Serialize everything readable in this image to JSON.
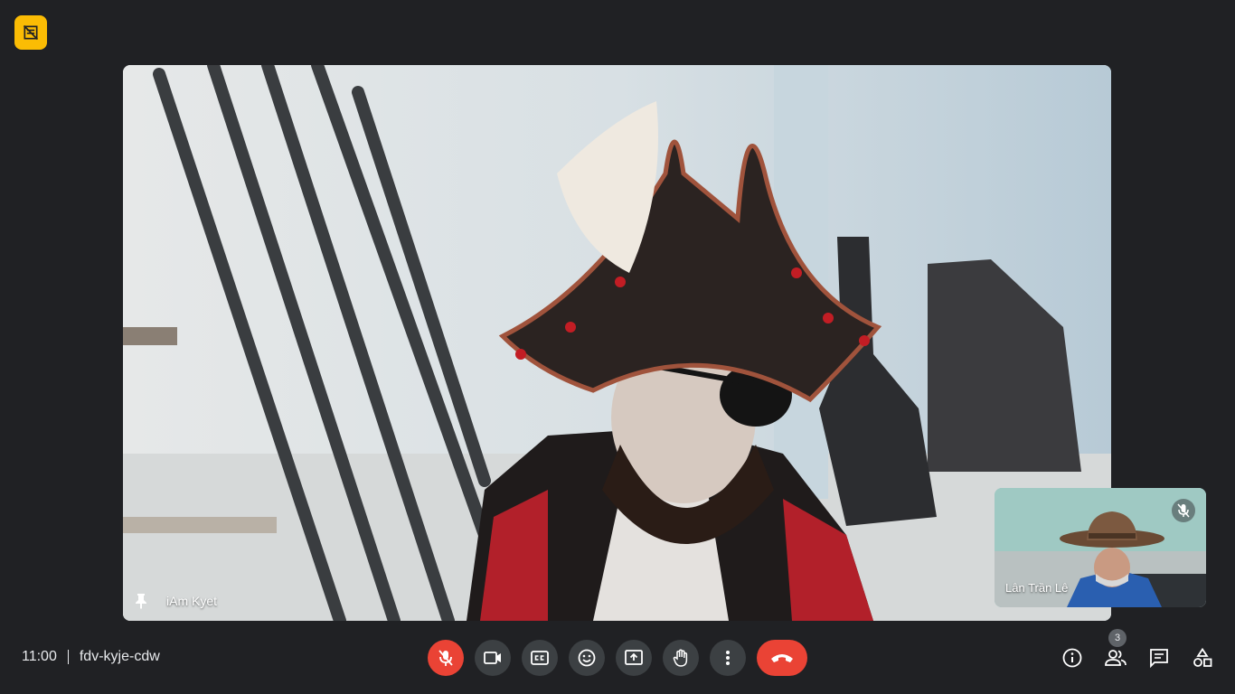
{
  "meeting": {
    "time": "11:00",
    "code": "fdv-kyje-cdw",
    "participant_count": "3"
  },
  "main_tile": {
    "name": "iAm Kyet"
  },
  "self_tile": {
    "name": "Lân Trần Lê"
  },
  "controls": [
    {
      "id": "mic",
      "icon": "mic-off-icon",
      "state": "muted"
    },
    {
      "id": "camera",
      "icon": "videocam-icon"
    },
    {
      "id": "captions",
      "icon": "closed-caption-icon"
    },
    {
      "id": "reactions",
      "icon": "emoji-icon"
    },
    {
      "id": "present",
      "icon": "present-screen-icon"
    },
    {
      "id": "raise-hand",
      "icon": "hand-icon"
    },
    {
      "id": "more",
      "icon": "more-vert-icon"
    },
    {
      "id": "leave",
      "icon": "call-end-icon"
    }
  ],
  "colors": {
    "background": "#202124",
    "button": "#3c4043",
    "danger": "#ea4335",
    "badge": "#fbbc04"
  }
}
